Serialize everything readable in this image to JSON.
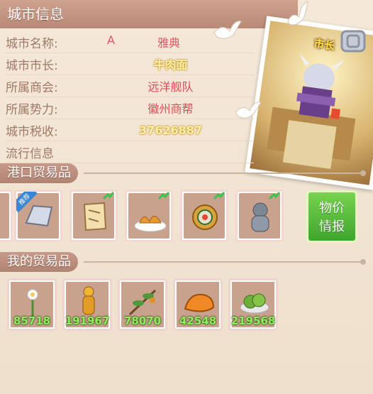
{
  "header": {
    "title": "城市信息"
  },
  "info": {
    "name_label": "城市名称:",
    "name_code": "A",
    "name_value": "雅典",
    "mayor_label": "城市市长:",
    "mayor_value": "牛肉面",
    "guild_label": "所属商会:",
    "guild_value": "远洋舰队",
    "power_label": "所属势力:",
    "power_value": "徽州商帮",
    "tax_label": "城市税收:",
    "tax_value": "37626887",
    "popular_label": "流行信息"
  },
  "portrait": {
    "title": "市长"
  },
  "port_goods": {
    "title": "港口贸易品",
    "recommend_badge": "推荐"
  },
  "price_button": {
    "line1": "物价",
    "line2": "情报"
  },
  "my_goods": {
    "title": "我的贸易品",
    "counts": [
      "85718",
      "191967",
      "78070",
      "42548",
      "219568"
    ]
  },
  "colors": {
    "accent_green": "#4cb035",
    "count_green": "#8df05a",
    "value_red": "#e35763",
    "header": "#c39484"
  },
  "icons": [
    "silver-ingot-icon",
    "parchment-map-icon",
    "dumpling-plate-icon",
    "ornate-mirror-icon",
    "stone-idol-icon",
    "white-flower-icon",
    "golden-figurine-icon",
    "herb-branch-icon",
    "orange-cloth-icon",
    "green-vegetable-icon",
    "dove-icon",
    "shield-chain-icon"
  ]
}
